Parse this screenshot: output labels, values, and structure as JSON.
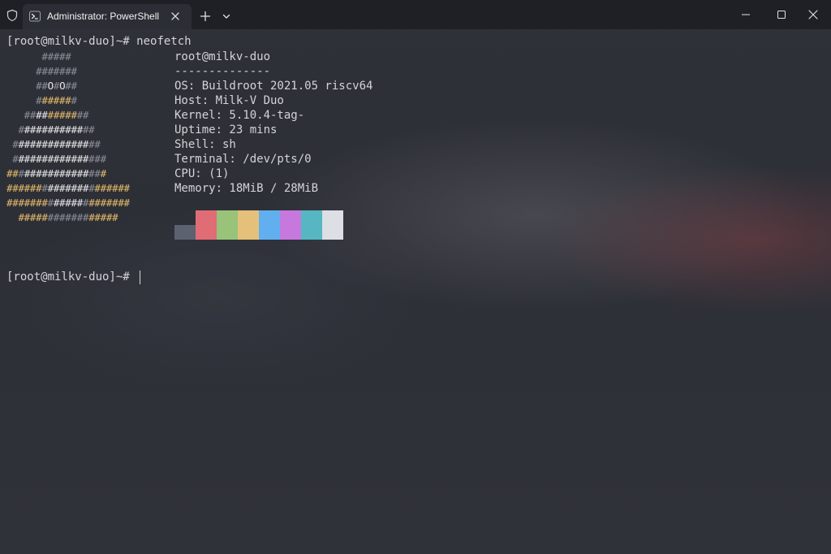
{
  "window": {
    "tab_title": "Administrator: PowerShell",
    "icons": {
      "shield": "shield-icon",
      "tab": "powershell-icon",
      "tab_close": "close-icon",
      "new_tab": "plus-icon",
      "dropdown": "chevron-down-icon",
      "minimize": "minimize-icon",
      "maximize": "maximize-icon",
      "close": "close-icon"
    }
  },
  "terminal": {
    "prompt": "[root@milkv-duo]~#",
    "command": "neofetch",
    "second_prompt": "[root@milkv-duo]~#",
    "logo_lines": [
      [
        {
          "t": "      #####",
          "c": "g"
        }
      ],
      [
        {
          "t": "     #######",
          "c": "g"
        }
      ],
      [
        {
          "t": "     ##",
          "c": "g"
        },
        {
          "t": "O",
          "c": "w"
        },
        {
          "t": "#",
          "c": "g"
        },
        {
          "t": "O",
          "c": "w"
        },
        {
          "t": "##",
          "c": "g"
        }
      ],
      [
        {
          "t": "     #",
          "c": "g"
        },
        {
          "t": "#####",
          "c": "y"
        },
        {
          "t": "#",
          "c": "g"
        }
      ],
      [
        {
          "t": "   ##",
          "c": "g"
        },
        {
          "t": "##",
          "c": "w"
        },
        {
          "t": "#####",
          "c": "y"
        },
        {
          "t": "##",
          "c": "g"
        }
      ],
      [
        {
          "t": "  #",
          "c": "g"
        },
        {
          "t": "##########",
          "c": "w"
        },
        {
          "t": "##",
          "c": "g"
        }
      ],
      [
        {
          "t": " #",
          "c": "g"
        },
        {
          "t": "############",
          "c": "w"
        },
        {
          "t": "##",
          "c": "g"
        }
      ],
      [
        {
          "t": " #",
          "c": "g"
        },
        {
          "t": "############",
          "c": "w"
        },
        {
          "t": "###",
          "c": "g"
        }
      ],
      [
        {
          "t": "##",
          "c": "y"
        },
        {
          "t": "#",
          "c": "g"
        },
        {
          "t": "###########",
          "c": "w"
        },
        {
          "t": "##",
          "c": "g"
        },
        {
          "t": "#",
          "c": "y"
        }
      ],
      [
        {
          "t": "######",
          "c": "y"
        },
        {
          "t": "#",
          "c": "g"
        },
        {
          "t": "#######",
          "c": "w"
        },
        {
          "t": "#",
          "c": "g"
        },
        {
          "t": "######",
          "c": "y"
        }
      ],
      [
        {
          "t": "#######",
          "c": "y"
        },
        {
          "t": "#",
          "c": "g"
        },
        {
          "t": "#####",
          "c": "w"
        },
        {
          "t": "#",
          "c": "g"
        },
        {
          "t": "#######",
          "c": "y"
        }
      ],
      [
        {
          "t": "  #####",
          "c": "y"
        },
        {
          "t": "#######",
          "c": "g"
        },
        {
          "t": "#####",
          "c": "y"
        }
      ]
    ],
    "info": {
      "user_host": "root@milkv-duo",
      "separator": "--------------",
      "os": "OS: Buildroot 2021.05 riscv64",
      "host": "Host: Milk-V Duo",
      "kernel": "Kernel: 5.10.4-tag-",
      "uptime": "Uptime: 23 mins",
      "shell": "Shell: sh",
      "terminal": "Terminal: /dev/pts/0",
      "cpu": "CPU: (1)",
      "memory": "Memory: 18MiB / 28MiB"
    },
    "palette": [
      "#5b6270",
      "#e06c75",
      "#98c379",
      "#e5c07b",
      "#61afef",
      "#c678dd",
      "#56b6c2",
      "#dcdfe4"
    ]
  }
}
